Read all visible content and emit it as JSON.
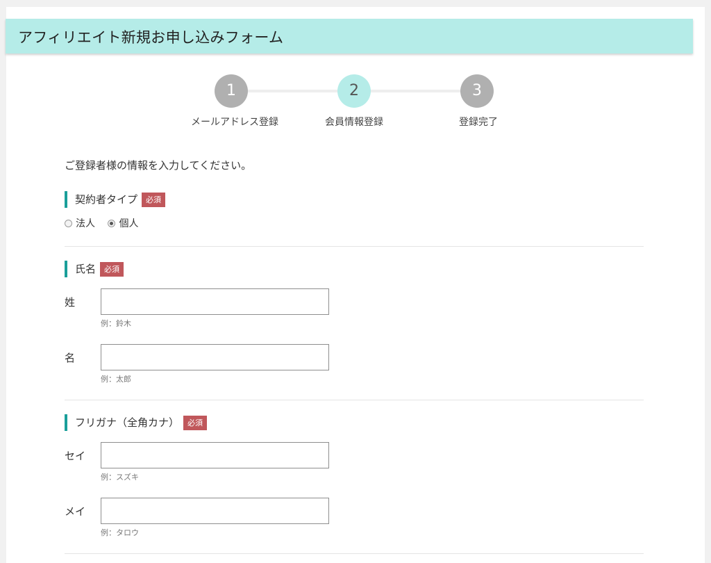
{
  "header": {
    "title": "アフィリエイト新規お申し込みフォーム"
  },
  "steps": [
    {
      "number": "1",
      "label": "メールアドレス登録"
    },
    {
      "number": "2",
      "label": "会員情報登録"
    },
    {
      "number": "3",
      "label": "登録完了"
    }
  ],
  "intro": "ご登録者様の情報を入力してください。",
  "required_badge": "必須",
  "contract_type": {
    "label": "契約者タイプ",
    "options": [
      {
        "label": "法人",
        "checked": false
      },
      {
        "label": "個人",
        "checked": true
      }
    ]
  },
  "name": {
    "label": "氏名",
    "fields": [
      {
        "label": "姓",
        "value": "",
        "hint": "例：鈴木"
      },
      {
        "label": "名",
        "value": "",
        "hint": "例：太郎"
      }
    ]
  },
  "furigana": {
    "label": "フリガナ（全角カナ）",
    "fields": [
      {
        "label": "セイ",
        "value": "",
        "hint": "例：スズキ"
      },
      {
        "label": "メイ",
        "value": "",
        "hint": "例：タロウ"
      }
    ]
  },
  "colors": {
    "header_bg": "#b5ece8",
    "accent": "#1a9f9a",
    "required": "#c0575b",
    "step_inactive": "#b0b0b0"
  }
}
